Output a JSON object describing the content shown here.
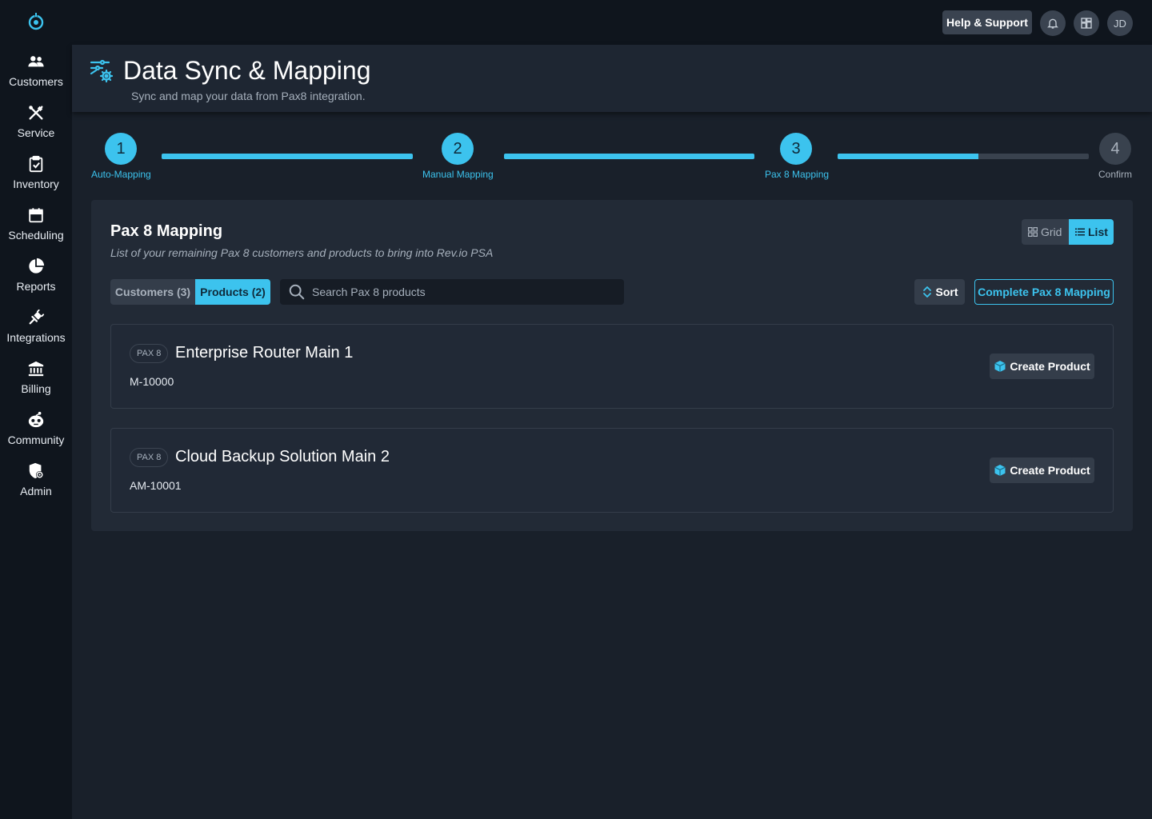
{
  "sidebar": {
    "items": [
      {
        "label": "Customers",
        "icon": "users-icon"
      },
      {
        "label": "Service",
        "icon": "tools-icon"
      },
      {
        "label": "Inventory",
        "icon": "clipboard-check-icon"
      },
      {
        "label": "Scheduling",
        "icon": "calendar-icon"
      },
      {
        "label": "Reports",
        "icon": "pie-chart-icon"
      },
      {
        "label": "Integrations",
        "icon": "plug-icon"
      },
      {
        "label": "Billing",
        "icon": "bank-icon"
      },
      {
        "label": "Community",
        "icon": "mascot-icon"
      },
      {
        "label": "Admin",
        "icon": "shield-gear-icon"
      }
    ]
  },
  "topbar": {
    "help_label": "Help & Support",
    "avatar_initials": "JD"
  },
  "header": {
    "title": "Data Sync & Mapping",
    "subtitle": "Sync and map your data from Pax8 integration."
  },
  "stepper": {
    "steps": [
      {
        "number": "1",
        "label": "Auto-Mapping",
        "state": "complete"
      },
      {
        "number": "2",
        "label": "Manual Mapping",
        "state": "complete"
      },
      {
        "number": "3",
        "label": "Pax 8 Mapping",
        "state": "current"
      },
      {
        "number": "4",
        "label": "Confirm",
        "state": "pending"
      }
    ],
    "progress": [
      1.0,
      1.0,
      0.56
    ]
  },
  "panel": {
    "title": "Pax 8 Mapping",
    "subtitle": "List of your remaining Pax 8 customers and products to bring into Rev.io PSA",
    "view_toggle": {
      "grid_label": "Grid",
      "list_label": "List",
      "selected": "List"
    },
    "tabs": [
      {
        "label": "Customers (3)",
        "selected": false
      },
      {
        "label": "Products (2)",
        "selected": true
      }
    ],
    "search_placeholder": "Search Pax 8 products",
    "sort_label": "Sort",
    "complete_label": "Complete Pax 8 Mapping",
    "products": [
      {
        "badge": "PAX 8",
        "name": "Enterprise Router Main 1",
        "code": "M-10000",
        "action": "Create Product"
      },
      {
        "badge": "PAX 8",
        "name": "Cloud Backup Solution Main 2",
        "code": "AM-10001",
        "action": "Create Product"
      }
    ]
  },
  "colors": {
    "accent": "#3cc3ee",
    "sidebar_bg": "#0f151d",
    "page_bg": "#19202a",
    "panel_bg": "#222a36",
    "button_bg": "#343d4a"
  }
}
